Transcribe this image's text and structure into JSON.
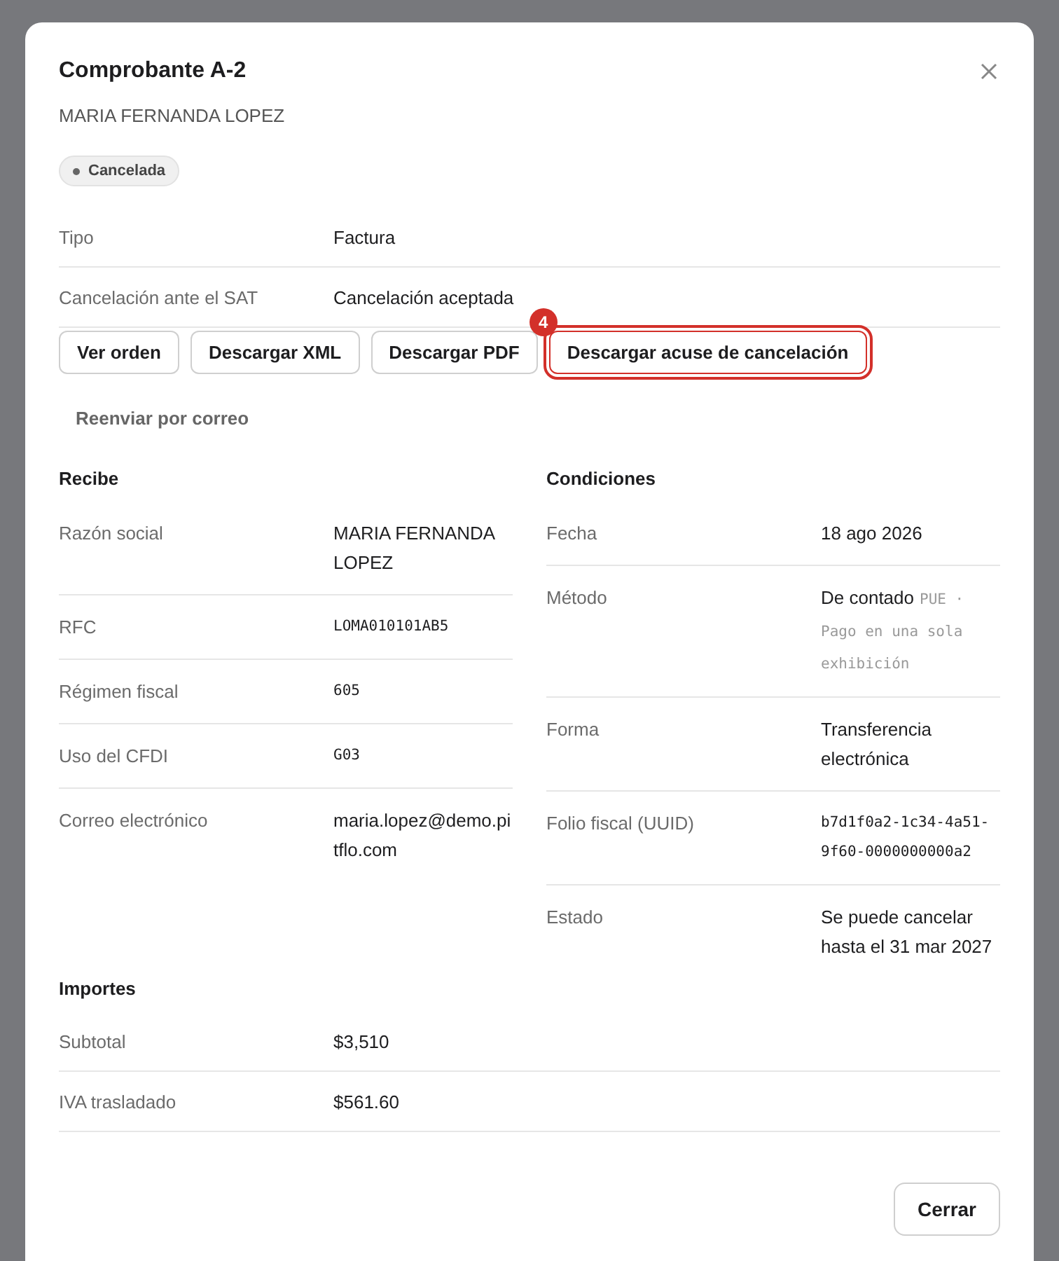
{
  "dialog": {
    "title": "Comprobante A-2",
    "subtitle": "MARIA FERNANDA LOPEZ",
    "status": "Cancelada"
  },
  "summary": [
    {
      "label": "Tipo",
      "value": "Factura"
    },
    {
      "label": "Cancelación ante el SAT",
      "value": "Cancelación aceptada"
    }
  ],
  "actions": [
    {
      "label": "Ver orden",
      "kind": "bold",
      "highlighted": false
    },
    {
      "label": "Descargar XML",
      "kind": "outline",
      "highlighted": false
    },
    {
      "label": "Descargar PDF",
      "kind": "outline",
      "highlighted": false
    },
    {
      "label": "Descargar acuse de cancelación",
      "kind": "outline",
      "highlighted": true,
      "badge": "4"
    },
    {
      "label": "Reenviar por correo",
      "kind": "link",
      "highlighted": false
    }
  ],
  "recibe": {
    "title": "Recibe",
    "rows": [
      {
        "label": "Razón social",
        "value": "MARIA FERNANDA LOPEZ",
        "mono": false
      },
      {
        "label": "RFC",
        "value": "LOMA010101AB5",
        "mono": true
      },
      {
        "label": "Régimen fiscal",
        "value": "605",
        "mono": true
      },
      {
        "label": "Uso del CFDI",
        "value": "G03",
        "mono": true
      },
      {
        "label": "Correo electrónico",
        "value": "maria.lopez@demo.pitflo.com",
        "mono": false
      }
    ]
  },
  "condiciones": {
    "title": "Condiciones",
    "rows": [
      {
        "label": "Fecha",
        "value": "18 ago 2026",
        "mono": false
      },
      {
        "label": "Método",
        "value": "De contado",
        "note": "PUE · Pago en una sola exhibición",
        "mono": false
      },
      {
        "label": "Forma",
        "value": "Transferencia electrónica",
        "mono": false
      },
      {
        "label": "Folio fiscal (UUID)",
        "value": "b7d1f0a2-1c34-4a51-9f60-0000000000a2",
        "mono": true
      },
      {
        "label": "Estado",
        "value": "Se puede cancelar hasta el 31 mar 2027",
        "mono": false
      }
    ]
  },
  "importes": {
    "title": "Importes",
    "rows": [
      {
        "label": "Subtotal",
        "value": "$3,510"
      },
      {
        "label": "IVA trasladado",
        "value": "$561.60"
      }
    ]
  },
  "footer": {
    "close": "Cerrar"
  }
}
